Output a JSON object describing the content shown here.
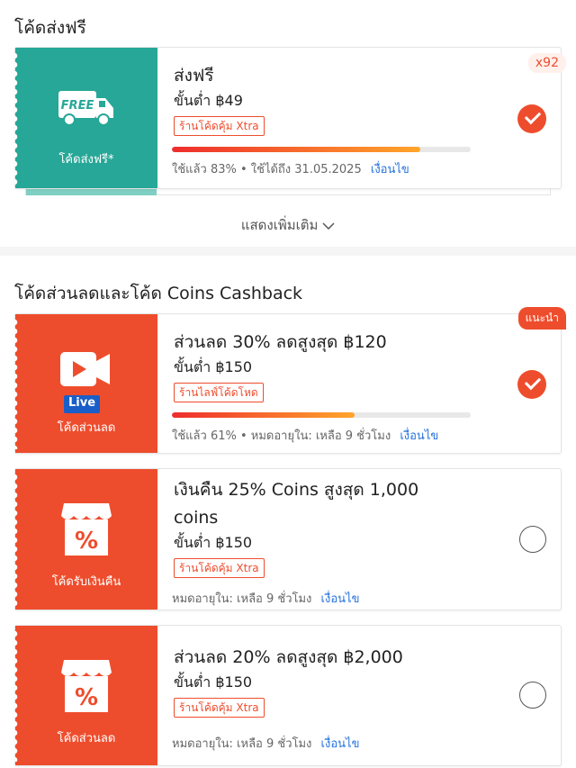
{
  "free_shipping": {
    "title": "โค้ดส่งฟรี",
    "card": {
      "icon_text": "FREE",
      "left_label": "โค้ดส่งฟรี*",
      "title": "ส่งฟรี",
      "min_spend": "ขั้นต่ำ ฿49",
      "tag": "ร้านโค้ดคุ้ม Xtra",
      "progress": 0.83,
      "usage": "ใช้แล้ว 83%",
      "validity": "• ใช้ได้ถึง 31.05.2025",
      "terms_link": "เงื่อนไข",
      "quantity_badge": "x92",
      "selected": true
    },
    "show_more": "แสดงเพิ่มเติม"
  },
  "discount": {
    "title": "โค้ดส่วนลดและโค้ด Coins Cashback",
    "cards": [
      {
        "icon": "live-video-icon",
        "icon_text": "Live",
        "left_label": "โค้ดส่วนลด",
        "title": "ส่วนลด 30% ลดสูงสุด ฿120",
        "min_spend": "ขั้นต่ำ ฿150",
        "tag": "ร้านไลฟ์โค้ดโหด",
        "progress": 0.61,
        "usage": "ใช้แล้ว 61%",
        "expiry": "• หมดอายุใน:  เหลือ 9 ชั่วโมง",
        "terms_link": "เงื่อนไข",
        "badge": "แนะนำ",
        "selected": true
      },
      {
        "icon": "shop-percent-icon",
        "left_label": "โค้ดรับเงินคืน",
        "title_line1": "เงินคืน 25% Coins สูงสุด 1,000",
        "title_line2": "coins",
        "min_spend": "ขั้นต่ำ ฿150",
        "tag": "ร้านโค้ดคุ้ม Xtra",
        "expiry": "หมดอายุใน:  เหลือ 9 ชั่วโมง",
        "terms_link": "เงื่อนไข",
        "selected": false
      },
      {
        "icon": "shop-percent-icon",
        "left_label": "โค้ดส่วนลด",
        "title": "ส่วนลด 20% ลดสูงสุด ฿2,000",
        "min_spend": "ขั้นต่ำ ฿150",
        "tag": "ร้านโค้ดคุ้ม Xtra",
        "expiry": "หมดอายุใน:  เหลือ 9 ชั่วโมง",
        "terms_link": "เงื่อนไข",
        "selected": false
      }
    ]
  },
  "colors": {
    "accent": "#ee4d2d",
    "teal": "#27a797",
    "link": "#2673dd"
  }
}
